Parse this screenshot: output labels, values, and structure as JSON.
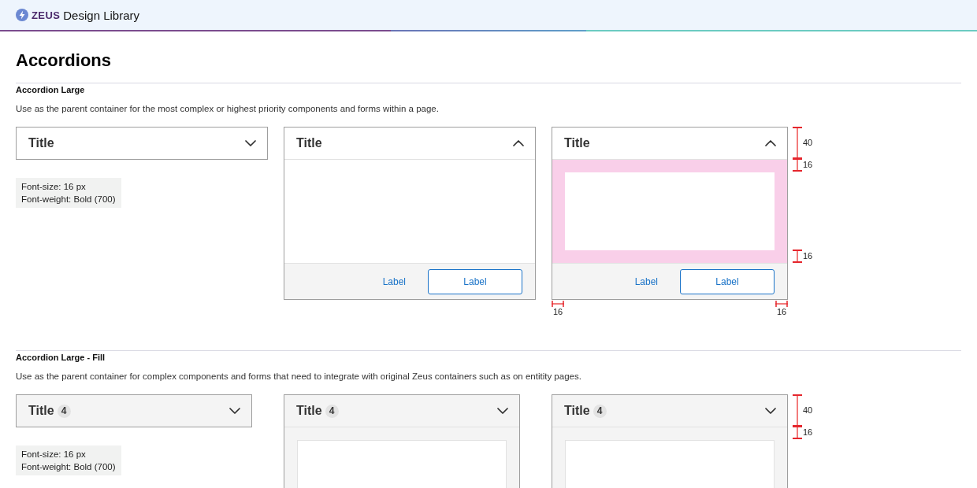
{
  "header": {
    "brand": "ZEUS",
    "product": "Design Library"
  },
  "page_title": "Accordions",
  "sections": [
    {
      "title": "Accordion Large",
      "description": "Use as the parent container for the most complex or highest priority components and forms within a page.",
      "examples": [
        {
          "kind": "outline",
          "title": "Title",
          "expanded": false,
          "chevron_up": false,
          "notes": [
            "Font-size: 16 px",
            "Font-weight: Bold (700)"
          ]
        },
        {
          "kind": "outline",
          "title": "Title",
          "expanded": true,
          "chevron_up": true,
          "padding_highlight": false,
          "footer": {
            "link": "Label",
            "button": "Label"
          }
        },
        {
          "kind": "outline",
          "title": "Title",
          "expanded": true,
          "chevron_up": true,
          "padding_highlight": true,
          "footer": {
            "link": "Label",
            "button": "Label"
          },
          "measurements": [
            {
              "kind": "header",
              "label": "40"
            },
            {
              "kind": "padding_top",
              "label": "16"
            },
            {
              "kind": "padding_bottom",
              "label": "16"
            },
            {
              "kind": "padding_left",
              "label": "16"
            },
            {
              "kind": "padding_right",
              "label": "16"
            }
          ]
        }
      ]
    },
    {
      "title": "Accordion Large - Fill",
      "description": "Use as the parent container for complex components and forms that need to integrate with original Zeus containers such as on entitity pages.",
      "examples": [
        {
          "kind": "fill",
          "title": "Title",
          "badge": "4",
          "expanded": false,
          "chevron_up": false,
          "notes": [
            "Font-size: 16 px",
            "Font-weight: Bold (700)"
          ]
        },
        {
          "kind": "fill",
          "title": "Title",
          "badge": "4",
          "expanded": true,
          "chevron_up": false,
          "padding_highlight": false
        },
        {
          "kind": "fill",
          "title": "Title",
          "badge": "4",
          "expanded": true,
          "chevron_up": false,
          "padding_highlight": false,
          "measurements": [
            {
              "kind": "header",
              "label": "40"
            },
            {
              "kind": "padding_top",
              "label": "16"
            }
          ]
        }
      ]
    }
  ]
}
